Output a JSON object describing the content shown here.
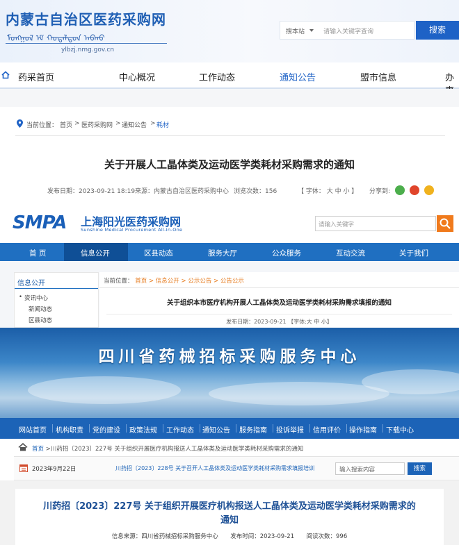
{
  "panel1": {
    "logo_cn": "内蒙古自治区医药采购网",
    "logo_mn": "ᠮᠣᠩᠭᠣᠯ ᠡᠮ ᠬᠤᠳᠠᠯᠳᠤᠨ ᠠᠪᠬᠤ",
    "url": "ylbzj.nmg.gov.cn",
    "search_scope": "搜本站",
    "search_placeholder": "请输入关键字查询",
    "search_button": "搜索",
    "nav": [
      "药采首页",
      "中心概况",
      "工作动态",
      "通知公告",
      "盟市信息",
      "办事"
    ],
    "active_nav": "通知公告",
    "breadcrumb_label": "当前位置：",
    "breadcrumb": [
      "首页",
      "医药采购网",
      "通知公告",
      "耗材"
    ],
    "title": "关于开展人工晶体类及运动医学类耗材采购需求的通知",
    "publish_date": "发布日期：2023-09-21 18:19",
    "source": "来源：内蒙古自治区医药采购中心",
    "views": "浏览次数：156",
    "font_size": "【 字体： 大   中   小 】",
    "share": "分享到:",
    "colors": {
      "brand": "#1e62c6",
      "wechat": "#4cae4c",
      "weibo": "#e0452b",
      "qzone": "#f0b21e"
    }
  },
  "panel2": {
    "logo_abbr": "SMPA",
    "logo_cn": "上海阳光医药采购网",
    "logo_en": "Sunshine Medical Procurement All-In-One",
    "search_placeholder": "请输入关键字",
    "nav": [
      "首 页",
      "信息公开",
      "区县动态",
      "服务大厅",
      "公众服务",
      "互动交流",
      "关于我们"
    ],
    "active_nav": "信息公开",
    "sidebar_title": "信息公开",
    "sidebar_items": [
      "资讯中心",
      "新闻动态",
      "区县动态"
    ],
    "breadcrumb_label": "当前位置：",
    "breadcrumb": [
      "首页",
      "信息公开",
      "公示公告",
      "公告公示"
    ],
    "title": "关于组织本市医疗机构开展人工晶体类及运动医学类耗材采购需求填报的通知",
    "meta": "发布日期：2023-09-21 【字体:大 中 小】",
    "colors": {
      "brand": "#1f6fc1",
      "accent": "#f07a1c"
    }
  },
  "panel3": {
    "banner_title": "四川省药械招标采购服务中心",
    "nav": [
      "网站首页",
      "机构职责",
      "党的建设",
      "政策法规",
      "工作动态",
      "通知公告",
      "服务指南",
      "投诉举报",
      "信用评价",
      "操作指南",
      "下载中心"
    ],
    "breadcrumb_home": "首页",
    "breadcrumb_rest": " >川药招〔2023〕227号 关于组织开展医疗机构报送人工晶体类及运动医学类耗材采购需求的通知",
    "date": "2023年9月22日",
    "marquee": "川药招〔2023〕228号 关于召开人工晶体类及运动医学类耗材采购需求填报培训",
    "search_placeholder": "输入搜索内容",
    "search_button": "搜索",
    "title": "川药招〔2023〕227号 关于组织开展医疗机构报送人工晶体类及运动医学类耗材采购需求的通知",
    "source": "信息来源：四川省药械招标采购服务中心",
    "publish_time": "发布时间：2023-09-21",
    "views": "阅读次数：996",
    "colors": {
      "brand": "#1c63b7"
    }
  }
}
